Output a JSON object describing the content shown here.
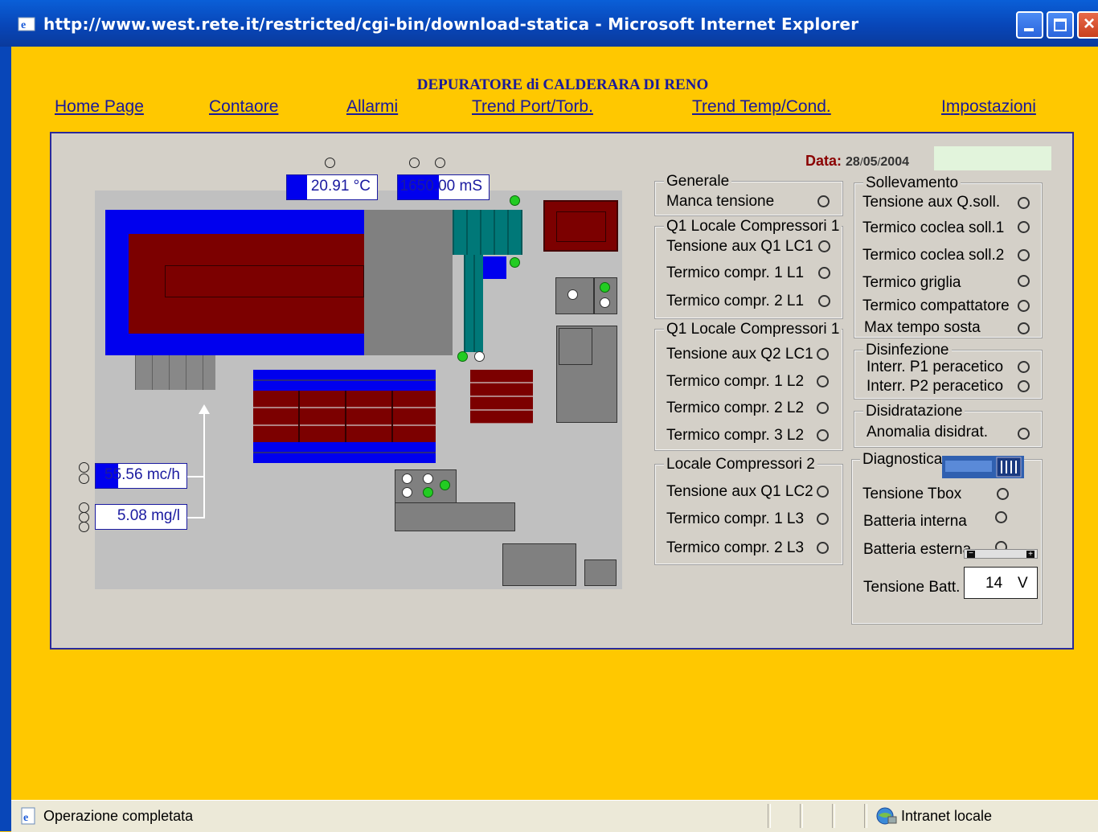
{
  "window": {
    "title": "http://www.west.rete.it/restricted/cgi-bin/download-statica - Microsoft Internet Explorer"
  },
  "header": {
    "title": "DEPURATORE di CALDERARA DI RENO",
    "nav": [
      "Home Page",
      "Contaore",
      "Allarmi",
      "Trend Port/Torb.",
      "Trend Temp/Cond.",
      "Impostazioni"
    ]
  },
  "data": {
    "label": "Data:",
    "day": "28",
    "month": "05",
    "year": "2004",
    "sep": "/"
  },
  "plant": {
    "temperature": {
      "value": "20.91 °C",
      "level": 0.22
    },
    "conductivity": {
      "value": "1650.00 mS",
      "level": 0.45
    },
    "flow": {
      "value": "55.56 mc/h",
      "level": 0.25
    },
    "concentration": {
      "value": "5.08 mg/l",
      "level": 0
    }
  },
  "groups": {
    "generale": {
      "title": "Generale",
      "items": [
        "Manca tensione"
      ]
    },
    "q1lc1": {
      "title": "Q1 Locale Compressori 1",
      "items": [
        "Tensione aux Q1 LC1",
        "Termico compr. 1 L1",
        "Termico compr. 2 L1"
      ]
    },
    "q1lc1b": {
      "title": "Q1 Locale Compressori 1",
      "items": [
        "Tensione aux Q2 LC1",
        "Termico compr. 1 L2",
        "Termico compr. 2 L2",
        "Termico compr. 3 L2"
      ]
    },
    "lc2": {
      "title": "Locale Compressori 2",
      "items": [
        "Tensione aux Q1 LC2",
        "Termico compr. 1 L3",
        "Termico compr. 2 L3"
      ]
    },
    "sollevamento": {
      "title": "Sollevamento",
      "items": [
        "Tensione aux Q.soll.",
        "Termico coclea soll.1",
        "Termico coclea soll.2",
        "Termico griglia",
        "Termico compattatore",
        "Max tempo sosta"
      ]
    },
    "disinfezione": {
      "title": "Disinfezione",
      "items": [
        "Interr. P1 peracetico",
        "Interr. P2 peracetico"
      ]
    },
    "disidratazione": {
      "title": "Disidratazione",
      "items": [
        "Anomalia disidrat."
      ]
    },
    "diagnostica": {
      "title": "Diagnostica",
      "items": [
        "Tensione Tbox",
        "Batteria interna",
        "Batteria esterna"
      ],
      "batt_label": "Tensione Batt.",
      "batt_value": "14",
      "batt_unit": "V"
    }
  },
  "status": {
    "text": "Operazione completata",
    "zone": "Intranet locale"
  }
}
